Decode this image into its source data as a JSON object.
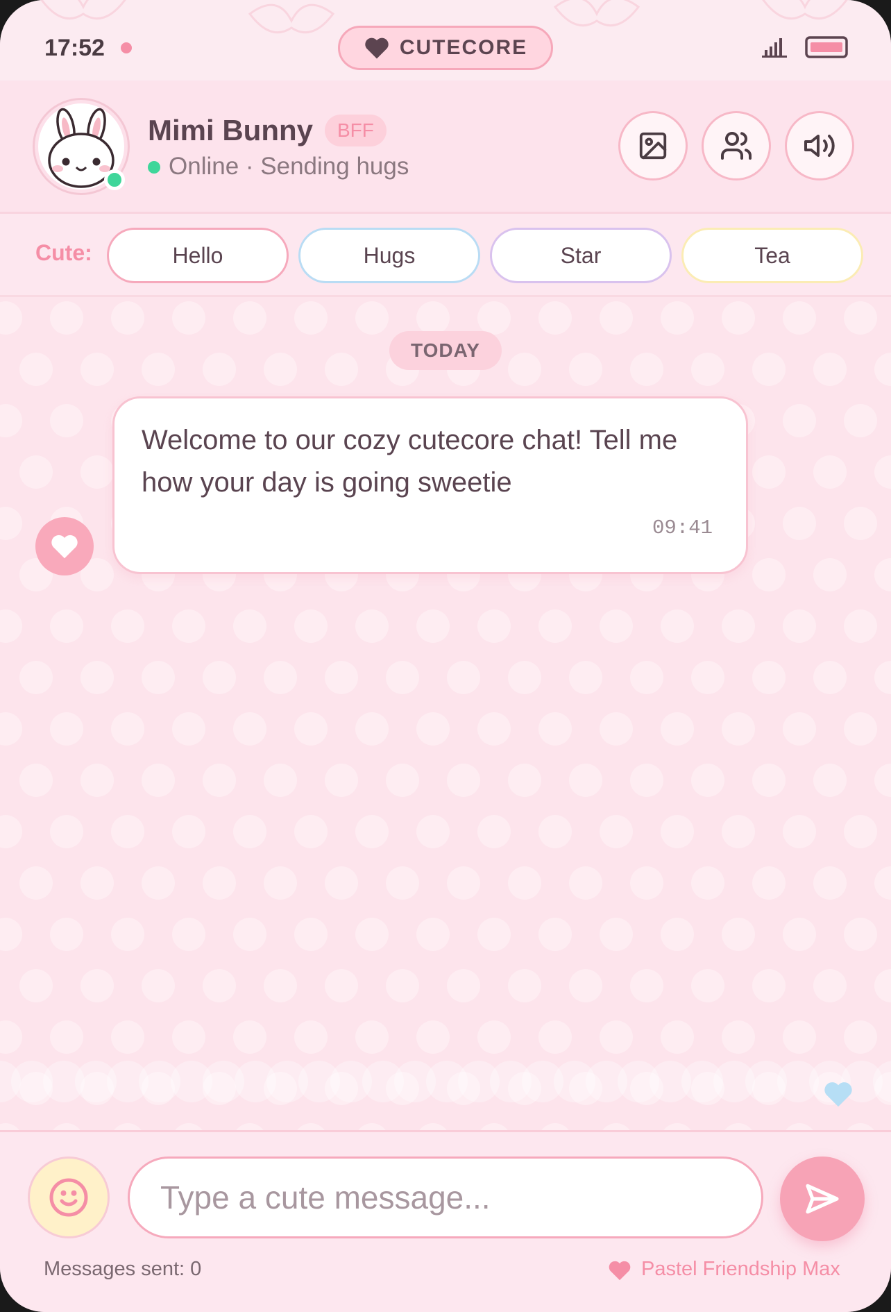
{
  "status_bar": {
    "time": "17:52",
    "app_name": "CUTECORE"
  },
  "header": {
    "contact_name": "Mimi Bunny",
    "badge": "BFF",
    "status_text": "Online · Sending hugs",
    "buttons": [
      "image-icon",
      "users-icon",
      "volume-icon"
    ]
  },
  "quick_replies": {
    "label": "Cute:",
    "chips": [
      {
        "label": "Hello",
        "border_color": "#f6a9bc"
      },
      {
        "label": "Hugs",
        "border_color": "#b9dcf4"
      },
      {
        "label": "Star",
        "border_color": "#d9c2ee"
      },
      {
        "label": "Tea",
        "border_color": "#fbecb4"
      }
    ]
  },
  "chat": {
    "date_divider": "TODAY",
    "messages": [
      {
        "text": "Welcome to our cozy cutecore chat! Tell me how your day is going sweetie",
        "time": "09:41"
      }
    ]
  },
  "composer": {
    "placeholder": "Type a cute message...",
    "messages_sent": "Messages sent: 0",
    "tagline": "Pastel Friendship Max"
  },
  "colors": {
    "accent_pink": "#f58ea6",
    "online_green": "#3fd69a",
    "background": "#fde7ef"
  }
}
